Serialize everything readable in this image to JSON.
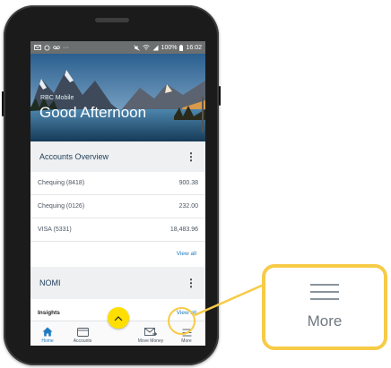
{
  "status_bar": {
    "left_icons": [
      "email-icon",
      "sync-icon",
      "voicemail-icon",
      "more-dots-icon"
    ],
    "signal": "100%",
    "time": "16:02"
  },
  "hero": {
    "app_name": "RBC Mobile",
    "greeting": "Good Afternoon"
  },
  "accounts_overview": {
    "title": "Accounts Overview",
    "accounts": [
      {
        "name": "Chequing (8418)",
        "balance": "900.38"
      },
      {
        "name": "Chequing (0126)",
        "balance": "232.00"
      },
      {
        "name": "VISA (5331)",
        "balance": "18,483.96"
      }
    ],
    "view_all": "View all"
  },
  "nomi": {
    "title": "NOMI",
    "insights_label": "Insights",
    "insights_link": "View all"
  },
  "bottom_nav": {
    "home": "Home",
    "accounts": "Accounts",
    "move_money": "Move Money",
    "more": "More"
  },
  "callout": {
    "label": "More",
    "icon": "hamburger-menu-icon"
  },
  "colors": {
    "highlight": "#f7cb47",
    "fab": "#fedf01",
    "brand_blue": "#1f7bbf",
    "section_bg": "#eef0f1"
  }
}
